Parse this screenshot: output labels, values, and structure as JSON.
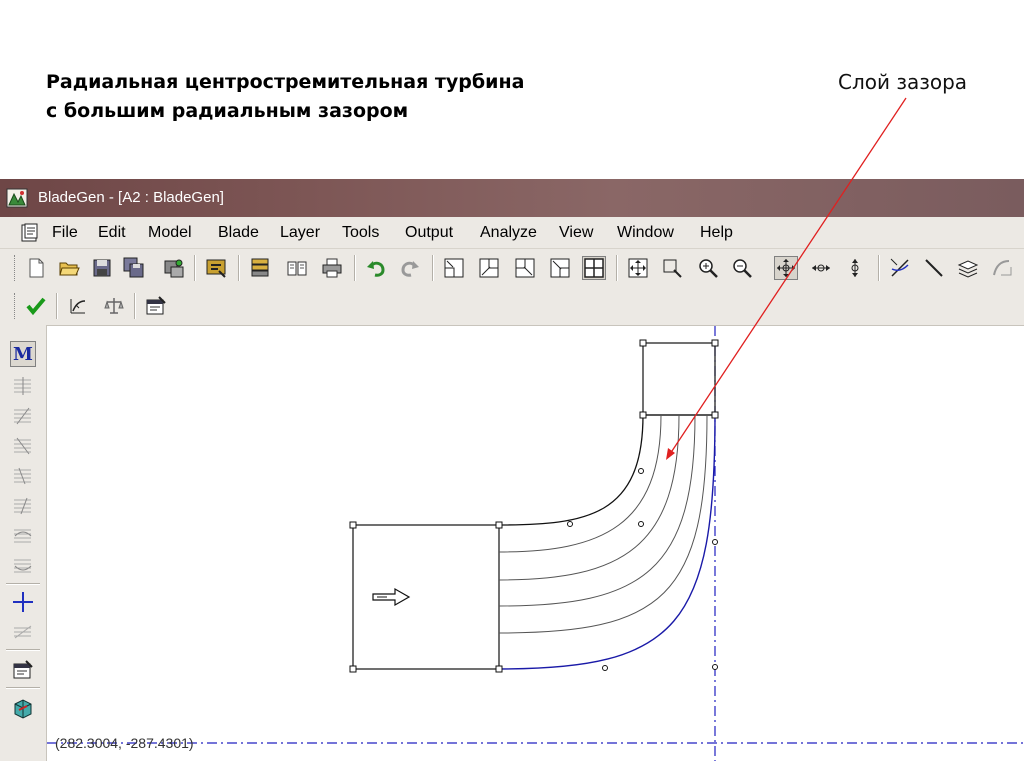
{
  "slide": {
    "title_line1": "Радиальная центростремительная турбина",
    "title_line2": "с большим радиальным зазором",
    "callout": "Слой зазора"
  },
  "window": {
    "title": "BladeGen - [A2 : BladeGen]"
  },
  "menu": [
    "File",
    "Edit",
    "Model",
    "Blade",
    "Layer",
    "Tools",
    "Output",
    "Analyze",
    "View",
    "Window",
    "Help"
  ],
  "toolbar": {
    "icons": [
      "new-file-icon",
      "open-folder-icon",
      "save-icon",
      "save-all-icon",
      "print-setup-icon",
      "import-icon",
      "layers-icon",
      "book-icon",
      "print-icon",
      "undo-icon",
      "redo-icon",
      "view-bottom-left-icon",
      "view-top-right-icon",
      "view-top-left-icon",
      "view-bottom-right-icon",
      "view-four-panes-icon",
      "fit-all-icon",
      "zoom-box-icon",
      "zoom-in-icon",
      "zoom-out-icon",
      "pan-icon",
      "pan-horizontal-icon",
      "pan-vertical-icon",
      "intersect-icon",
      "line-icon",
      "layer-stack-icon",
      "blade-profile-icon"
    ],
    "second_row_icons": [
      "check-icon",
      "blade-angle-icon",
      "balance-icon",
      "properties-icon"
    ]
  },
  "left_toolbar": {
    "mode_label": "M",
    "icons": [
      "meridional-mode-icon",
      "layer-1-icon",
      "layer-2-icon",
      "layer-3-icon",
      "layer-4-icon",
      "layer-5-icon",
      "layer-6-icon",
      "layer-7-icon",
      "axis-cross-icon",
      "layer-8-icon",
      "properties-icon",
      "3d-view-icon"
    ]
  },
  "status": {
    "coordinates": "(282.3004, -287.4301)"
  },
  "colors": {
    "titlebar": "#7a5253",
    "toolbar_bg": "#ece9e4",
    "hub_line": "#1a1aa8",
    "axis_line": "#2020c0",
    "callout_arrow": "#e02020"
  }
}
